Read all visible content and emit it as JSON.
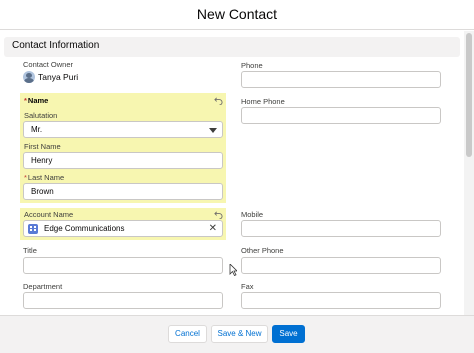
{
  "modal": {
    "title": "New Contact"
  },
  "section": {
    "title": "Contact Information"
  },
  "fields": {
    "contact_owner": {
      "label": "Contact Owner",
      "value": "Tanya Puri"
    },
    "name": {
      "label": "Name",
      "required_mark": "*"
    },
    "salutation": {
      "label": "Salutation",
      "value": "Mr."
    },
    "first_name": {
      "label": "First Name",
      "value": "Henry"
    },
    "last_name": {
      "label": "Last Name",
      "required_mark": "*",
      "value": "Brown"
    },
    "account_name": {
      "label": "Account Name",
      "value": "Edge Communications"
    },
    "title": {
      "label": "Title",
      "value": ""
    },
    "department": {
      "label": "Department",
      "value": ""
    },
    "phone": {
      "label": "Phone",
      "value": ""
    },
    "home_phone": {
      "label": "Home Phone",
      "value": ""
    },
    "mobile": {
      "label": "Mobile",
      "value": ""
    },
    "other_phone": {
      "label": "Other Phone",
      "value": ""
    },
    "fax": {
      "label": "Fax",
      "value": ""
    }
  },
  "buttons": {
    "cancel": "Cancel",
    "save_new": "Save & New",
    "save": "Save"
  },
  "icons": {
    "owner_avatar": "user-avatar-icon",
    "undo": "undo-icon",
    "account": "account-icon",
    "clear": "close-icon",
    "caret": "chevron-down-icon"
  },
  "colors": {
    "highlight": "#f7f6b0",
    "primary": "#0070d2",
    "required": "#c23934"
  }
}
